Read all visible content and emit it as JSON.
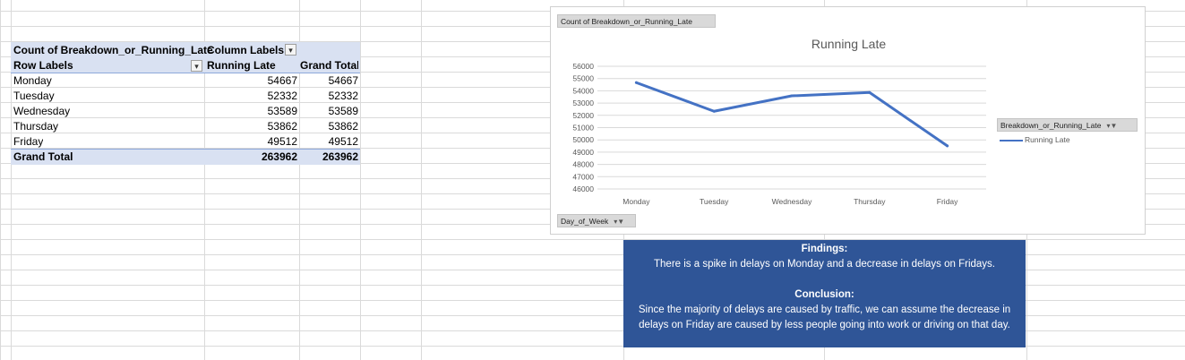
{
  "pivot": {
    "header1": "Count of Breakdown_or_Running_Late",
    "header2": "Column Labels",
    "row_labels_header": "Row Labels",
    "col_header": "Running Late",
    "grand_total_header": "Grand Total",
    "rows": [
      {
        "label": "Monday",
        "running_late": "54667",
        "grand_total": "54667"
      },
      {
        "label": "Tuesday",
        "running_late": "52332",
        "grand_total": "52332"
      },
      {
        "label": "Wednesday",
        "running_late": "53589",
        "grand_total": "53589"
      },
      {
        "label": "Thursday",
        "running_late": "53862",
        "grand_total": "53862"
      },
      {
        "label": "Friday",
        "running_late": "49512",
        "grand_total": "49512"
      }
    ],
    "total": {
      "label": "Grand Total",
      "running_late": "263962",
      "grand_total": "263962"
    }
  },
  "chart": {
    "value_field_button": "Count of Breakdown_or_Running_Late",
    "axis_field_button": "Day_of_Week",
    "legend_field_button": "Breakdown_or_Running_Late",
    "legend_item": "Running Late",
    "line_color": "#4472c4"
  },
  "chart_data": {
    "type": "line",
    "title": "Running Late",
    "categories": [
      "Monday",
      "Tuesday",
      "Wednesday",
      "Thursday",
      "Friday"
    ],
    "series": [
      {
        "name": "Running Late",
        "values": [
          54667,
          52332,
          53589,
          53862,
          49512
        ]
      }
    ],
    "ylim": [
      46000,
      56000
    ],
    "yticks": [
      "46000",
      "47000",
      "48000",
      "49000",
      "50000",
      "51000",
      "52000",
      "53000",
      "54000",
      "55000",
      "56000"
    ],
    "grid": true,
    "legend": "right"
  },
  "findings": {
    "heading": "Findings:",
    "text": "There is a spike in delays on Monday and a decrease in delays on Fridays.",
    "conclusion_heading": "Conclusion:",
    "conclusion_text": "Since the majority of delays are caused by traffic, we can assume the decrease in delays on Friday are caused by less people going into work or driving on that day."
  }
}
